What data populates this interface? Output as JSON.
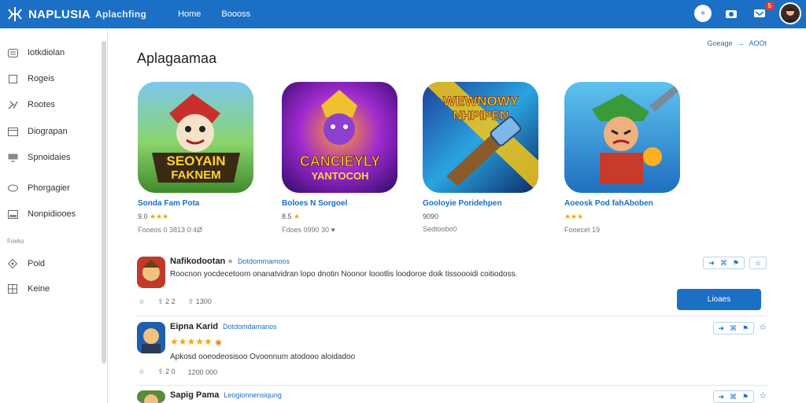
{
  "header": {
    "brand": "NAPLUSIA",
    "subtitle": "Aplachfing",
    "nav": [
      "Home",
      "Boooss"
    ],
    "notification_count": "5"
  },
  "sidebar": {
    "items": [
      {
        "label": "Iotkdiolan",
        "icon": "list-icon"
      },
      {
        "label": "Rogeis",
        "icon": "square-icon"
      },
      {
        "label": "Rootes",
        "icon": "tools-icon"
      },
      {
        "label": "Diograpan",
        "icon": "window-icon"
      },
      {
        "label": "Spnoidaies",
        "icon": "monitor-icon"
      },
      {
        "label": "Phorgagier",
        "icon": "chat-icon"
      },
      {
        "label": "Nonpidiooes",
        "icon": "box-icon"
      }
    ],
    "section_label": "Foeks",
    "section_items": [
      {
        "label": "Poid",
        "icon": "diamond-icon"
      },
      {
        "label": "Keine",
        "icon": "grid-icon"
      }
    ]
  },
  "main": {
    "title": "Aplagaamaa",
    "top_links": [
      "Goeage",
      "AOOt"
    ],
    "apps": [
      {
        "name": "Sonda Fam Pota",
        "rating": "9.0",
        "stars": "★★★",
        "meta": "Fooeos 0 3813 0:4Ø",
        "palette": "green"
      },
      {
        "name": "Boloes N Sorgoel",
        "rating": "8.5",
        "stars": "★",
        "meta": "Fdoes 0990 30 ♥",
        "palette": "purple"
      },
      {
        "name": "Gooloyie Poridehpen",
        "rating": "9090",
        "stars": "",
        "meta": "Sedtoobo0",
        "palette": "blue"
      },
      {
        "name": "Aoeosk Pod fahAboben",
        "rating": "",
        "stars": "★★★",
        "meta": "Fooecet 19",
        "palette": "cyan"
      }
    ],
    "app_icon_text": [
      {
        "line1": "SEOYAIN",
        "line2": "FAKNEM"
      },
      {
        "line1": "CANCIEYLY",
        "line2": "YANTOCOH"
      },
      {
        "line1": "WEWNOWY",
        "line2": "NHPIPEN"
      },
      {
        "line1": "",
        "line2": ""
      }
    ],
    "reviews": [
      {
        "name": "Nafikodootan",
        "tag": "Dotdommamoos",
        "text": "Roocnon yocdecetoom onanatvidran lopo dnotin Noonor loootlis loodoroe doik tissoooidi coitiodoss.",
        "likes": "2 2",
        "time": "1300"
      },
      {
        "name": "Eipna Karid",
        "tag": "Dotdomdamanos",
        "stars": "★★★★★",
        "text": "Apkosd ooeodeosisoo Ovoonnum atodooo aloidadoo",
        "likes": "2 0",
        "time": "1200 000"
      },
      {
        "name": "Sapig Pama",
        "tag": "Leogionnensiqung"
      }
    ],
    "primary_button": "Lioaes"
  }
}
